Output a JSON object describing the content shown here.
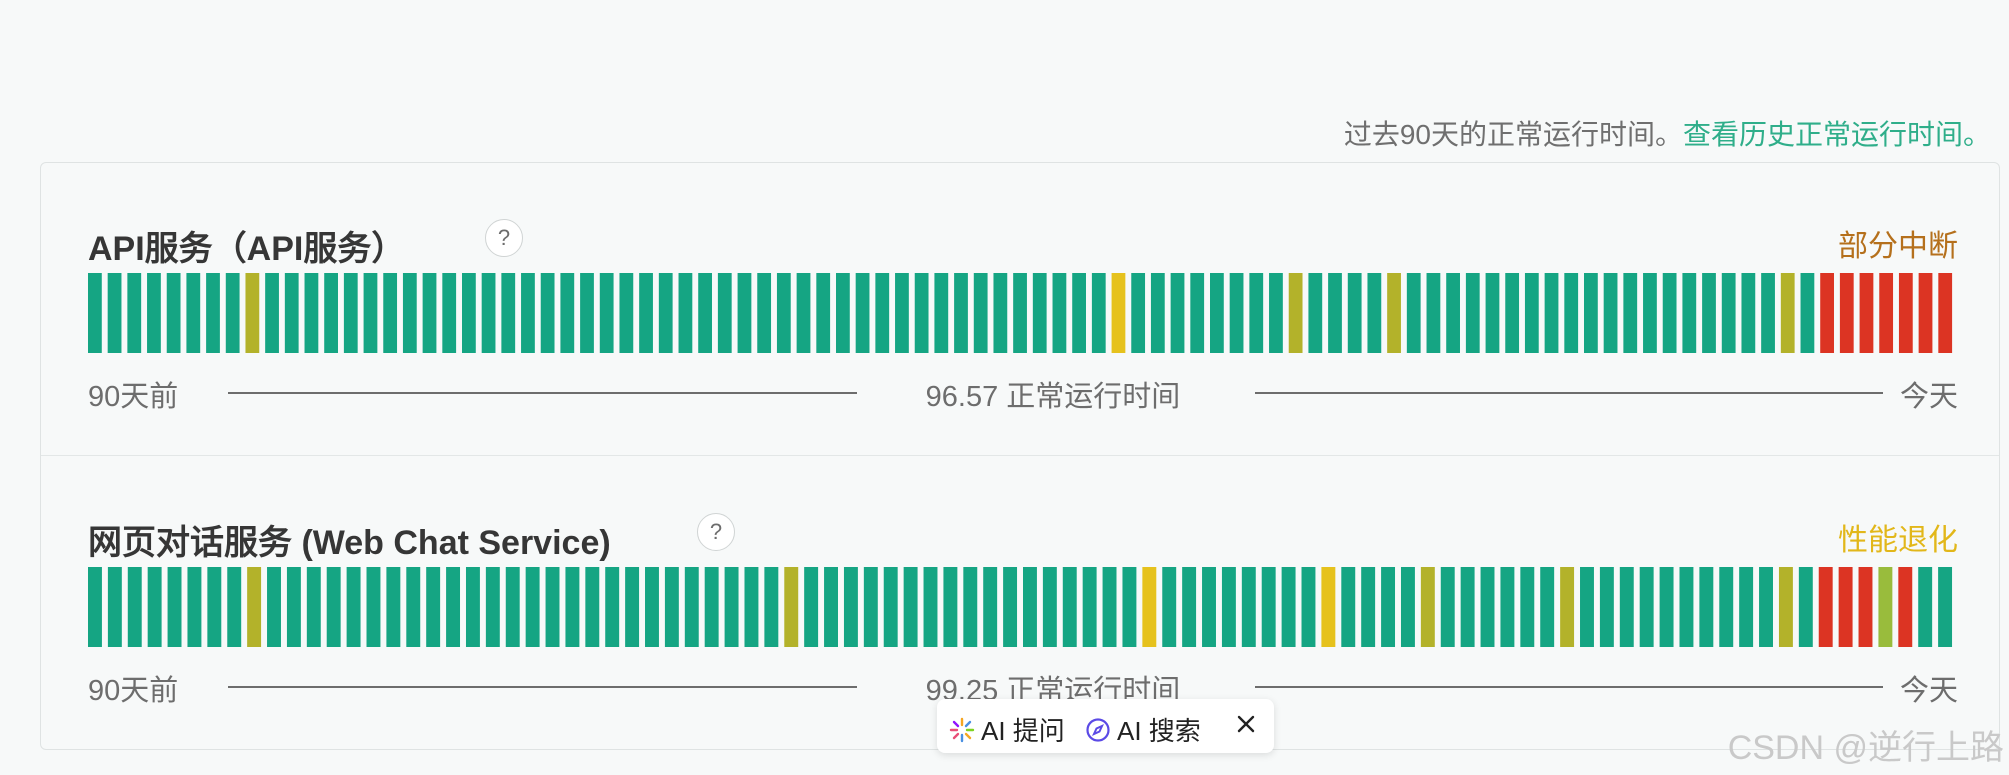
{
  "header": {
    "note": "过去90天的正常运行时间。",
    "history_link": "查看历史正常运行时间。"
  },
  "components": [
    {
      "name": "API服务（API服务）",
      "help": "?",
      "status": "部分中断",
      "status_color": "#b5701c",
      "days": "GGGGGGGGOGGGGGGGGGGGGGGGGGGGGGGGGGGGGGGGGGGGGGGGGGGGYGGGGGGGGOGGGGOGGGGGGGGGGGGGGGGGGGOGRRRRRRR",
      "left_label": "90天前",
      "uptime": "96.57 正常运行时间",
      "right_label": "今天"
    },
    {
      "name": "网页对话服务 (Web Chat Service)",
      "help": "?",
      "status": "性能退化",
      "status_color": "#e2b71a",
      "days": "GGGGGGGGOGGGGGGGGGGGGGGGGGGGGGGGGGGOGGGGGGGGGGGGGGGGGYGGGGGGGGYGGGGOGGGGGGOGGGGGGGGGGOGRRRLRGG",
      "left_label": "90天前",
      "uptime": "99.25 正常运行时间",
      "right_label": "今天"
    }
  ],
  "bar_colors": {
    "G": "#15a583",
    "O": "#b3b22a",
    "Y": "#e6c21d",
    "L": "#99bc3c",
    "R": "#dc3423"
  },
  "ai_toolbar": {
    "ask_label": "AI 提问",
    "search_label": "AI 搜索",
    "ask_icon": "sparkle-icon",
    "search_icon": "compass-icon",
    "close_icon": "close-icon"
  },
  "watermark": "CSDN @逆行上路"
}
